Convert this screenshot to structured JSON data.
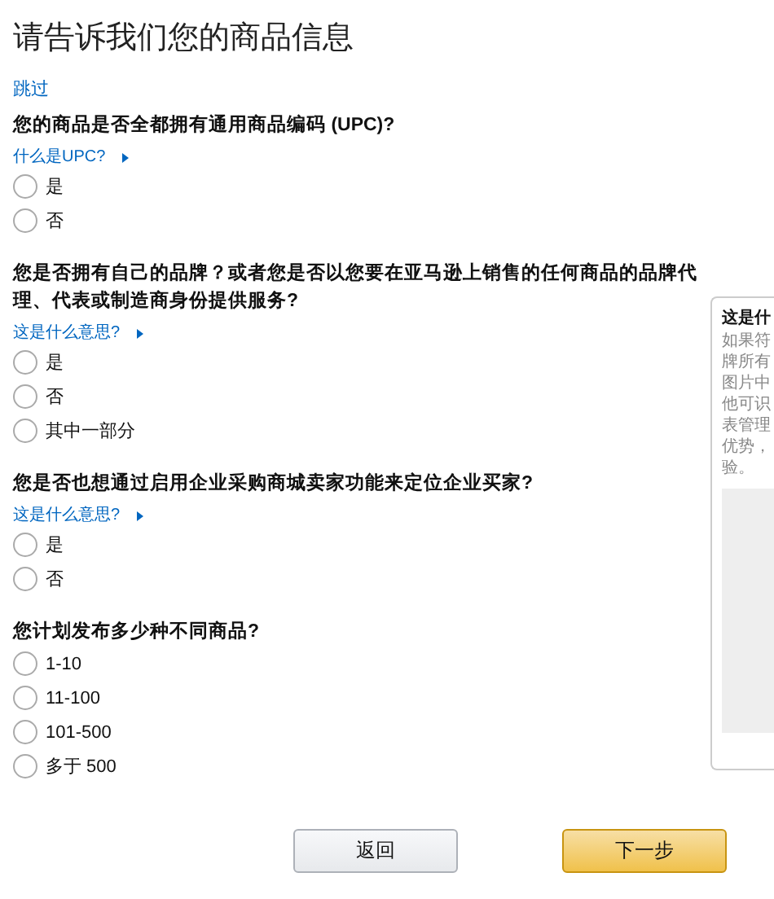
{
  "title": "请告诉我们您的商品信息",
  "skip_link": "跳过",
  "questions": [
    {
      "text": "您的商品是否全都拥有通用商品编码 (UPC)?",
      "help": "什么是UPC?",
      "options": [
        {
          "label": "是",
          "selected": false
        },
        {
          "label": "否",
          "selected": false
        }
      ]
    },
    {
      "text": "您是否拥有自己的品牌？或者您是否以您要在亚马逊上销售的任何商品的品牌代理、代表或制造商身份提供服务?",
      "help": "这是什么意思?",
      "options": [
        {
          "label": "是",
          "selected": false
        },
        {
          "label": "否",
          "selected": false
        },
        {
          "label": "其中一部分",
          "selected": false
        }
      ]
    },
    {
      "text": "您是否也想通过启用企业采购商城卖家功能来定位企业买家?",
      "help": "这是什么意思?",
      "options": [
        {
          "label": "是",
          "selected": false
        },
        {
          "label": "否",
          "selected": false
        }
      ]
    },
    {
      "text": "您计划发布多少种不同商品?",
      "options": [
        {
          "label": "1-10",
          "selected": false
        },
        {
          "label": "11-100",
          "selected": false
        },
        {
          "label": "101-500",
          "selected": false
        },
        {
          "label": "多于 500",
          "selected": false
        }
      ]
    }
  ],
  "help_panel": {
    "title": "这是什",
    "lines": [
      "如果符",
      "牌所有",
      "图片中",
      "他可识",
      "表管理",
      "优势，",
      "验。"
    ]
  },
  "buttons": [
    {
      "label": "返回",
      "kind": "secondary"
    },
    {
      "label": "下一步",
      "kind": "primary"
    }
  ]
}
